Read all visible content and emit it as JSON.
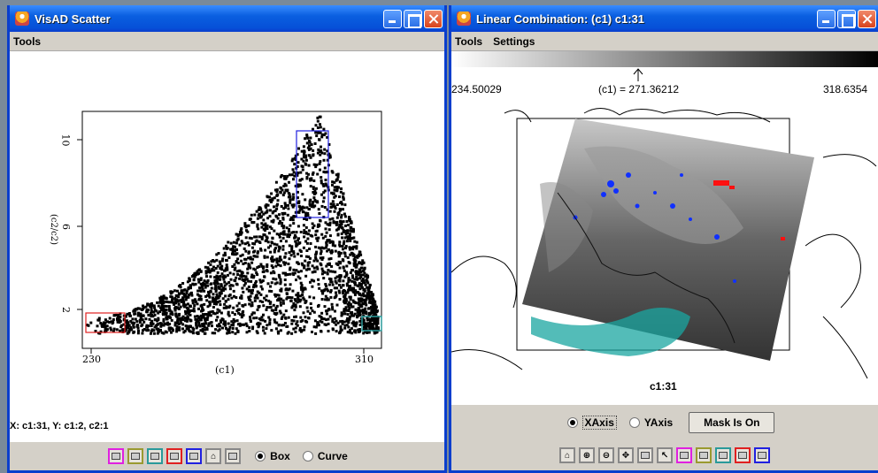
{
  "left": {
    "title": "VisAD Scatter",
    "menu": [
      "Tools"
    ],
    "plot": {
      "x_label": "(c1)",
      "y_label": "(c2/c2)",
      "x_ticks": [
        "230",
        "310"
      ],
      "y_ticks": [
        "10",
        "6",
        "2"
      ]
    },
    "status": "X: c1:31,  Y: c1:2,  c2:1",
    "toolbar": {
      "swatch_colors": [
        "#e020e0",
        "#9a9a30",
        "#2a9a9a",
        "#e02020",
        "#2020e0"
      ],
      "radio_box": "Box",
      "radio_curve": "Curve",
      "selected": "Box"
    }
  },
  "right": {
    "title": "Linear Combination: (c1)  c1:31",
    "menu": [
      "Tools",
      "Settings"
    ],
    "scale": {
      "min": "234.50029",
      "current": "(c1) = 271.36212",
      "max": "318.6354"
    },
    "map_caption": "c1:31",
    "axis": {
      "x": "XAxis",
      "y": "YAxis",
      "selected": "XAxis"
    },
    "mask_button": "Mask Is On",
    "toolbar": {
      "swatch_colors": [
        "#e020e0",
        "#9a9a30",
        "#2a9a9a",
        "#e02020",
        "#2020e0"
      ]
    }
  }
}
